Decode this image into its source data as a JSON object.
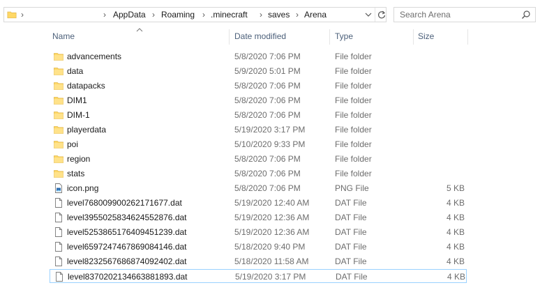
{
  "address_bar": {
    "breadcrumbs": [
      "AppData",
      "Roaming",
      ".minecraft",
      "saves",
      "Arena"
    ]
  },
  "search": {
    "placeholder": "Search Arena"
  },
  "columns": {
    "name": "Name",
    "date_modified": "Date modified",
    "type": "Type",
    "size": "Size",
    "sorted_by": "Name",
    "sort_direction": "ascending"
  },
  "files": [
    {
      "name": "advancements",
      "date": "5/8/2020 7:06 PM",
      "type": "File folder",
      "size": "",
      "icon": "folder-icon"
    },
    {
      "name": "data",
      "date": "5/9/2020 5:01 PM",
      "type": "File folder",
      "size": "",
      "icon": "folder-icon"
    },
    {
      "name": "datapacks",
      "date": "5/8/2020 7:06 PM",
      "type": "File folder",
      "size": "",
      "icon": "folder-icon"
    },
    {
      "name": "DIM1",
      "date": "5/8/2020 7:06 PM",
      "type": "File folder",
      "size": "",
      "icon": "folder-icon"
    },
    {
      "name": "DIM-1",
      "date": "5/8/2020 7:06 PM",
      "type": "File folder",
      "size": "",
      "icon": "folder-icon"
    },
    {
      "name": "playerdata",
      "date": "5/19/2020 3:17 PM",
      "type": "File folder",
      "size": "",
      "icon": "folder-icon"
    },
    {
      "name": "poi",
      "date": "5/10/2020 9:33 PM",
      "type": "File folder",
      "size": "",
      "icon": "folder-icon"
    },
    {
      "name": "region",
      "date": "5/8/2020 7:06 PM",
      "type": "File folder",
      "size": "",
      "icon": "folder-icon"
    },
    {
      "name": "stats",
      "date": "5/8/2020 7:06 PM",
      "type": "File folder",
      "size": "",
      "icon": "folder-icon"
    },
    {
      "name": "icon.png",
      "date": "5/8/2020 7:06 PM",
      "type": "PNG File",
      "size": "5 KB",
      "icon": "image-file-icon"
    },
    {
      "name": "level768009900262171677.dat",
      "date": "5/19/2020 12:40 AM",
      "type": "DAT File",
      "size": "4 KB",
      "icon": "file-icon"
    },
    {
      "name": "level3955025834624552876.dat",
      "date": "5/19/2020 12:36 AM",
      "type": "DAT File",
      "size": "4 KB",
      "icon": "file-icon"
    },
    {
      "name": "level5253865176409451239.dat",
      "date": "5/19/2020 12:36 AM",
      "type": "DAT File",
      "size": "4 KB",
      "icon": "file-icon"
    },
    {
      "name": "level6597247467869084146.dat",
      "date": "5/18/2020 9:40 PM",
      "type": "DAT File",
      "size": "4 KB",
      "icon": "file-icon"
    },
    {
      "name": "level8232567686874092402.dat",
      "date": "5/18/2020 11:58 AM",
      "type": "DAT File",
      "size": "4 KB",
      "icon": "file-icon"
    },
    {
      "name": "level8370202134663881893.dat",
      "date": "5/19/2020 3:17 PM",
      "type": "DAT File",
      "size": "4 KB",
      "icon": "file-icon",
      "selected": true
    }
  ],
  "colors": {
    "folder": "#ffd866",
    "header_text": "#4c607a",
    "secondary_text": "#6d6d6d",
    "selection_border": "#99d1ff"
  }
}
